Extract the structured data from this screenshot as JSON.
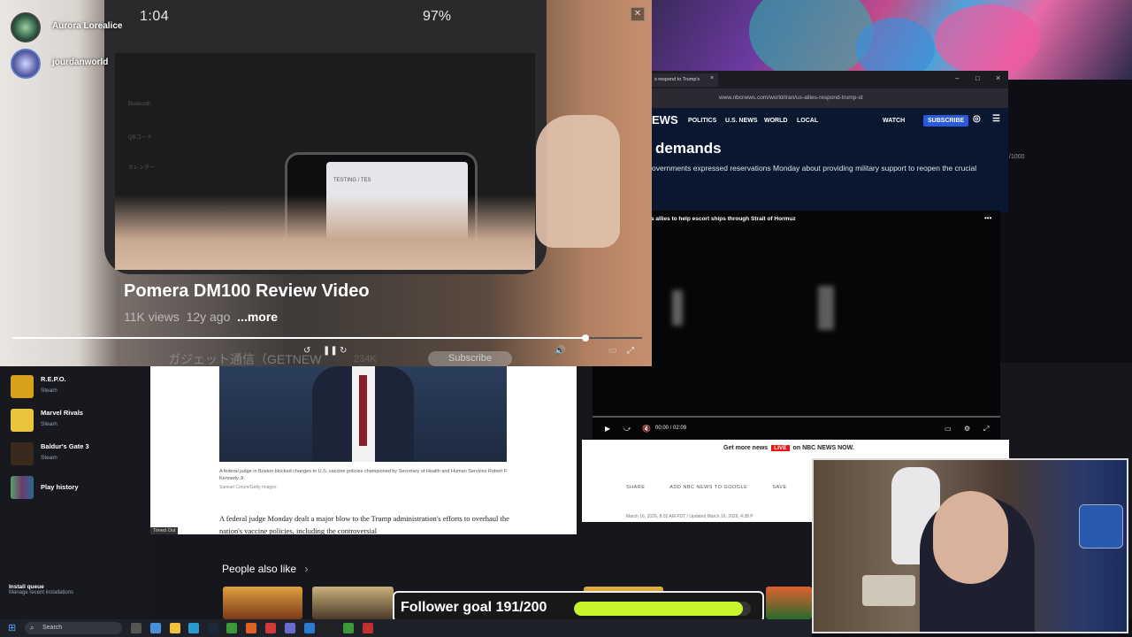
{
  "youtube_player": {
    "status_time": "1:04",
    "status_battery": "97%",
    "video_title": "Pomera DM100 Review Video",
    "views": "11K views",
    "age": "12y ago",
    "more": "...more",
    "channel": "ガジェット通信（GETNEW",
    "subscribers": "234K",
    "subscribe": "Subscribe",
    "timecode": "7:33 / 8:18",
    "progress_fraction": 0.91,
    "phone_screen_text": "TESTING / TES",
    "phone_menu": [
      "Bluetooth",
      "QRコード",
      "カレンダー"
    ]
  },
  "chat": [
    {
      "name": "Aurora Lorealice"
    },
    {
      "name": "jourdanworld"
    }
  ],
  "launcher": {
    "games": [
      {
        "name": "R.E.P.O.",
        "platform": "Steam"
      },
      {
        "name": "Marvel Rivals",
        "platform": "Steam"
      },
      {
        "name": "Baldur's Gate 3",
        "platform": "Steam"
      },
      {
        "name": "Play history",
        "platform": ""
      }
    ],
    "install_queue": {
      "title": "Install queue",
      "subtitle": "Manage recent installations"
    }
  },
  "article": {
    "caption": "A federal judge in Boston blocked changes to U.S. vaccine policies championed by Secretary of Health and Human Services Robert F. Kennedy Jr.",
    "credit": "Samuel Corum/Getty Images",
    "body": "A federal judge Monday dealt a major blow to the Trump administration's efforts to overhaul the nation's vaccine policies, including the controversial",
    "timed_out": "Timed Out"
  },
  "browser": {
    "tab_title": "s respond to Trump's",
    "url": "www.nbcnews.com/world/iran/us-allies-respond-trump-st",
    "logo_fragment": "EWS",
    "nav": [
      "POLITICS",
      "U.S. NEWS",
      "WORLD",
      "LOCAL"
    ],
    "watch": "WATCH",
    "subscribe": "SUBSCRIBE",
    "headline": "demands",
    "dek": "overnments expressed reservations Monday about providing military support to reopen the crucial",
    "side_fraction": "/1000"
  },
  "nbc_video": {
    "title": "s allies to help escort ships through Strait of Hormuz",
    "time": "00:00 / 02:09"
  },
  "nbc_lower": {
    "promo_pre": "Get more news",
    "live": "LIVE",
    "promo_mid": "on",
    "promo_brand": "NBC NEWS NOW.",
    "actions": [
      "SHARE",
      "ADD NBC NEWS TO GOOGLE",
      "SAVE"
    ],
    "date": "March 16, 2026, 8:02 AM PDT / Updated March 16, 2026, 4:38 P"
  },
  "people_also_like": {
    "label": "People also like",
    "chevron": "›"
  },
  "follower_goal": {
    "label": "Follower goal 191/200",
    "current": 191,
    "target": 200
  },
  "taskbar": {
    "search": "Search"
  },
  "colors": {
    "accent": "#c5f52a",
    "nbc_blue": "#2a5ad9",
    "live_red": "#e11"
  }
}
